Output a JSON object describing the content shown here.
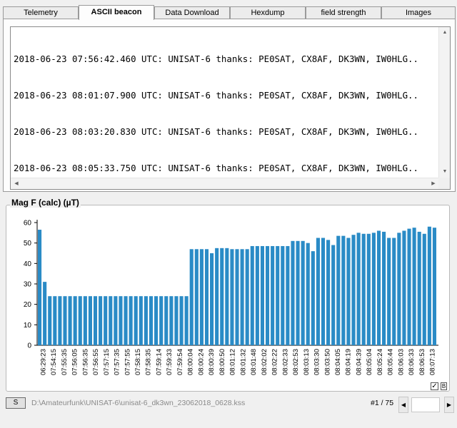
{
  "tabs": [
    {
      "label": "Telemetry",
      "active": false
    },
    {
      "label": "ASCII beacon",
      "active": true
    },
    {
      "label": "Data Download",
      "active": false
    },
    {
      "label": "Hexdump",
      "active": false
    },
    {
      "label": "field strength",
      "active": false
    },
    {
      "label": "Images",
      "active": false
    }
  ],
  "beacon_lines": [
    "2018-06-23 07:56:42.460 UTC: UNISAT-6 thanks: PE0SAT, CX8AF, DK3WN, IW0HLG..",
    "2018-06-23 08:01:07.900 UTC: UNISAT-6 thanks: PE0SAT, CX8AF, DK3WN, IW0HLG..",
    "2018-06-23 08:03:20.830 UTC: UNISAT-6 thanks: PE0SAT, CX8AF, DK3WN, IW0HLG..",
    "2018-06-23 08:05:33.750 UTC: UNISAT-6 thanks: PE0SAT, CX8AF, DK3WN, IW0HLG.."
  ],
  "group_title": "Mag F (calc) (µT)",
  "bottom": {
    "s_button": "S",
    "file_path": "D:\\Amateurfunk\\UNISAT-6\\unisat-6_dk3wn_23062018_0628.kss",
    "counter": "#1 / 75"
  },
  "colors": {
    "bar": "#2a8bc6",
    "accent": "#2a8bc6"
  },
  "icons": {
    "scroll_up": "triangle-up-icon",
    "scroll_down": "triangle-down-icon",
    "scroll_left": "triangle-left-icon",
    "scroll_right": "triangle-right-icon"
  },
  "chart_data": {
    "type": "bar",
    "title": "Mag F (calc) (µT)",
    "ylim": [
      0,
      60
    ],
    "yticks": [
      0,
      10,
      20,
      30,
      40,
      50,
      60
    ],
    "grid": false,
    "x_tick_labels": [
      "06:29:23",
      "07:54:15",
      "07:55:35",
      "07:56:05",
      "07:56:35",
      "07:56:55",
      "07:57:15",
      "07:57:35",
      "07:57:55",
      "07:58:15",
      "07:58:35",
      "07:59:14",
      "07:59:33",
      "07:59:54",
      "08:00:04",
      "08:00:24",
      "08:00:39",
      "08:00:50",
      "08:01:12",
      "08:01:32",
      "08:01:48",
      "08:02:02",
      "08:02:22",
      "08:02:33",
      "08:02:53",
      "08:03:13",
      "08:03:30",
      "08:03:50",
      "08:04:05",
      "08:04:19",
      "08:04:39",
      "08:05:04",
      "08:05:24",
      "08:05:44",
      "08:06:03",
      "08:06:33",
      "08:06:53",
      "08:07:13"
    ],
    "values": [
      56.5,
      31,
      24,
      24,
      24,
      24,
      24,
      24,
      24,
      24,
      24,
      24,
      24,
      24,
      24,
      24,
      24,
      24,
      24,
      24,
      24,
      24,
      24,
      24,
      24,
      24,
      24,
      24,
      24,
      24,
      47,
      47,
      47,
      47,
      45,
      47.5,
      47.5,
      47.5,
      47,
      47,
      47,
      47,
      48.5,
      48.5,
      48.5,
      48.5,
      48.5,
      48.5,
      48.5,
      48.5,
      51,
      51,
      51,
      50,
      46,
      52.5,
      52.5,
      51.5,
      49,
      53.5,
      53.5,
      52.5,
      54,
      55,
      54.5,
      54.5,
      55,
      56,
      55.5,
      52.5,
      52.5,
      55,
      56,
      57,
      57.5,
      55.5,
      54.5,
      58,
      57.5
    ]
  }
}
